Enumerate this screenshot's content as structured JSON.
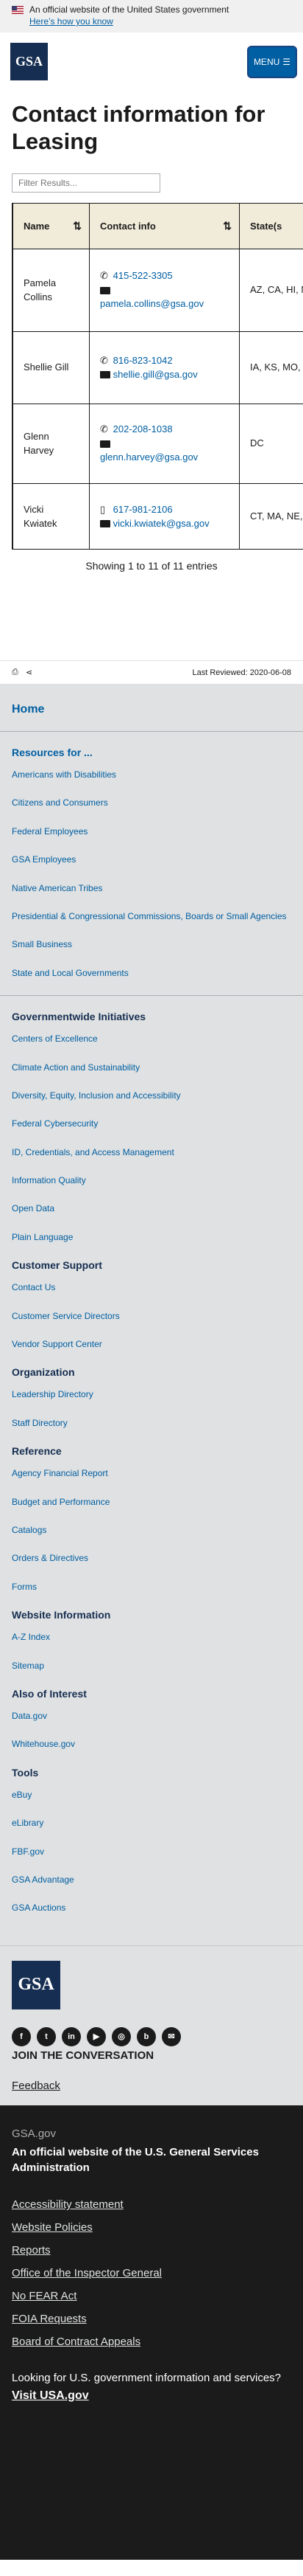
{
  "banner": {
    "text": "An official website of the United States government",
    "how_link": "Here’s how you know"
  },
  "header": {
    "logo": "GSA",
    "menu": "MENU"
  },
  "title": "Contact information for Leasing",
  "filter_placeholder": "Filter Results...",
  "table": {
    "headers": [
      "Name",
      "Contact info",
      "State(s"
    ],
    "rows": [
      {
        "name": "Pamela Collins",
        "phone": "415-522-3305",
        "email": "pamela.collins@gsa.gov",
        "states": "AZ, CA, HI, NV"
      },
      {
        "name": "Shellie Gill",
        "phone": "816-823-1042",
        "email": "shellie.gill@gsa.gov",
        "states": "IA, KS, MO, NE"
      },
      {
        "name": "Glenn Harvey",
        "phone": "202-208-1038",
        "email": "glenn.harvey@gsa.gov",
        "states": "DC"
      },
      {
        "name": "Vicki Kwiatek",
        "phone": "617-981-2106",
        "email": "vicki.kwiatek@gsa.gov",
        "states": "CT, MA, NE, NH, RI, VT"
      }
    ],
    "info": "Showing 1 to 11 of 11 entries"
  },
  "page_tools": {
    "last_reviewed": "Last Reviewed: 2020-06-08"
  },
  "footer_nav": {
    "home": "Home",
    "sections": [
      {
        "title": "Resources for ...",
        "items": [
          "Americans with Disabilities",
          "Citizens and Consumers",
          "Federal Employees",
          "GSA Employees",
          "Native American Tribes",
          "Presidential & Congressional Commissions, Boards or Small Agencies",
          "Small Business",
          "State and Local Governments"
        ]
      },
      {
        "title": "Governmentwide Initiatives",
        "items": [
          "Centers of Excellence",
          "Climate Action and Sustainability",
          "Diversity, Equity, Inclusion and Accessibility",
          "Federal Cybersecurity",
          "ID, Credentials, and Access Management",
          "Information Quality",
          "Open Data",
          "Plain Language"
        ]
      },
      {
        "title": "Customer Support",
        "items": [
          "Contact Us",
          "Customer Service Directors",
          "Vendor Support Center"
        ]
      },
      {
        "title": "Organization",
        "items": [
          "Leadership Directory",
          "Staff Directory"
        ]
      },
      {
        "title": "Reference",
        "items": [
          "Agency Financial Report",
          "Budget and Performance",
          "Catalogs",
          "Orders & Directives",
          "Forms"
        ]
      },
      {
        "title": "Website Information",
        "items": [
          "A-Z Index",
          "Sitemap"
        ]
      },
      {
        "title": "Also of Interest",
        "items": [
          "Data.gov",
          "Whitehouse.gov"
        ]
      },
      {
        "title": "Tools",
        "items": [
          "eBuy",
          "eLibrary",
          "FBF.gov",
          "GSA Advantage",
          "GSA Auctions"
        ]
      }
    ]
  },
  "footer_mid": {
    "logo": "GSA",
    "join": "JOIN THE CONVERSATION",
    "feedback": "Feedback"
  },
  "identifier": {
    "domain": "GSA.gov",
    "official": "An official website of the U.S. General Services Administration",
    "links": [
      "Accessibility statement",
      "Website Policies",
      "Reports",
      "Office of the Inspector General",
      "No FEAR Act",
      "FOIA Requests",
      "Board of Contract Appeals"
    ],
    "usa_text": "Looking for U.S. government information and services?",
    "visit": "Visit USA.gov"
  }
}
